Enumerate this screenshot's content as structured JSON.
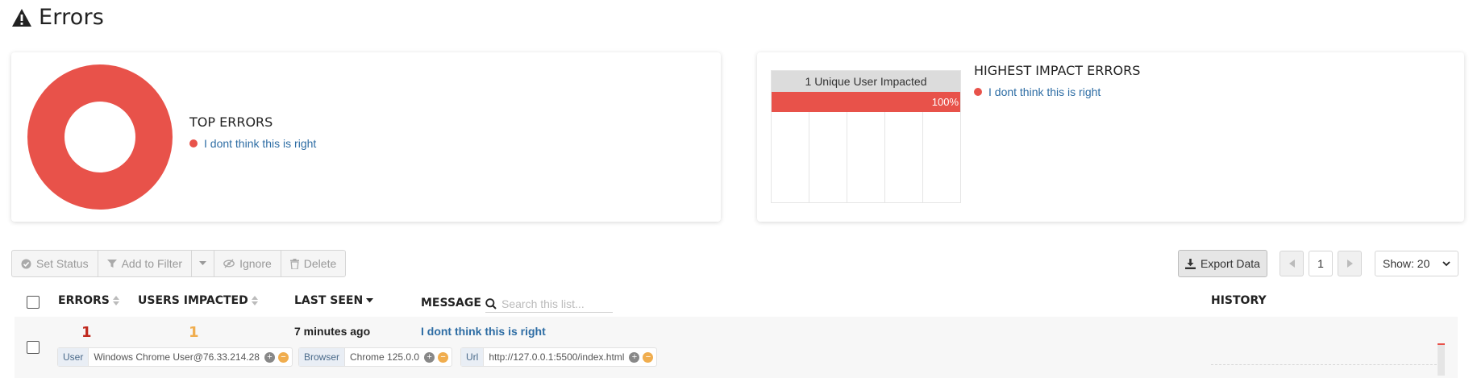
{
  "page": {
    "title": "Errors",
    "icon": "warning-triangle-icon"
  },
  "top_errors": {
    "title": "TOP ERRORS",
    "items": [
      {
        "label": "I dont think this is right",
        "color": "#e8524a"
      }
    ]
  },
  "impact": {
    "bar_header": "1 Unique User Impacted",
    "bar_percent": "100%",
    "bar_fraction": 1.0,
    "title": "HIGHEST IMPACT ERRORS",
    "items": [
      {
        "label": "I dont think this is right",
        "color": "#e8524a"
      }
    ]
  },
  "toolbar": {
    "set_status": "Set Status",
    "add_to_filter": "Add to Filter",
    "ignore": "Ignore",
    "delete": "Delete"
  },
  "export_label": "Export Data",
  "pagination": {
    "current_page": "1"
  },
  "show_select": {
    "selected": "Show: 20"
  },
  "columns": {
    "errors": "ERRORS",
    "users_impacted": "USERS IMPACTED",
    "last_seen": "LAST SEEN",
    "message": "MESSAGE",
    "history": "HISTORY"
  },
  "search": {
    "placeholder": "Search this list...",
    "value": ""
  },
  "rows": [
    {
      "errors": "1",
      "users_impacted": "1",
      "last_seen": "7 minutes ago",
      "message": "I dont think this is right",
      "tags": [
        {
          "key": "User",
          "value": "Windows Chrome User@76.33.214.28"
        },
        {
          "key": "Browser",
          "value": "Chrome 125.0.0"
        },
        {
          "key": "Url",
          "value": "http://127.0.0.1:5500/index.html"
        }
      ]
    }
  ],
  "colors": {
    "accent_red": "#e8524a",
    "link_blue": "#2e6da4",
    "error_count_red": "#c0281e",
    "users_count_orange": "#f0ad4e"
  }
}
